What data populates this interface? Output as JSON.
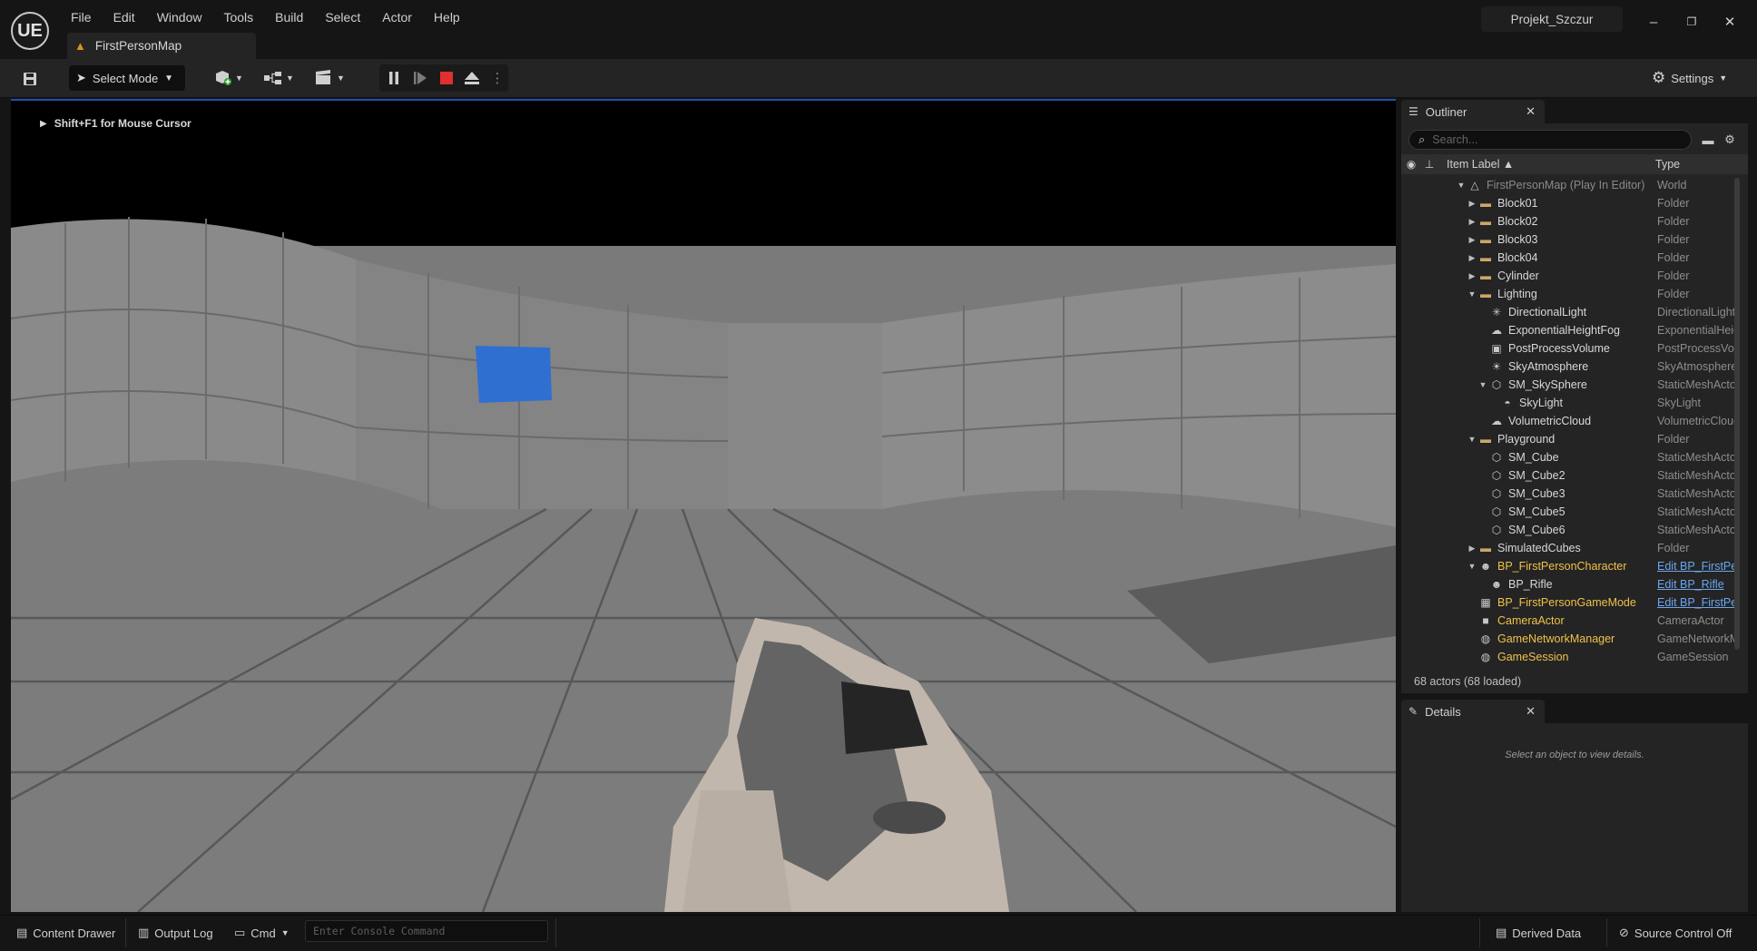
{
  "app": {
    "logo": "UE",
    "menu": [
      "File",
      "Edit",
      "Window",
      "Tools",
      "Build",
      "Select",
      "Actor",
      "Help"
    ],
    "level_tab": "FirstPersonMap",
    "project": "Projekt_Szczur",
    "window_controls": {
      "minimize": "–",
      "restore": "❐",
      "close": "✕"
    }
  },
  "toolbar": {
    "select_mode": "Select Mode",
    "settings": "Settings",
    "icons": [
      "save-icon",
      "add-actor-icon",
      "blueprint-icon",
      "cinematics-icon",
      "pause-icon",
      "step-icon",
      "stop-icon",
      "eject-icon",
      "more-icon"
    ]
  },
  "viewport": {
    "mouse_hint": "Shift+F1 for Mouse Cursor",
    "accent_color": "#1e4fa8",
    "target_color": "#2f6fd0"
  },
  "outliner": {
    "tab_label": "Outliner",
    "search_placeholder": "Search...",
    "col_label": "Item Label ▲",
    "col_type": "Type",
    "rows": [
      {
        "label": "FirstPersonMap (Play In Editor)",
        "type": "World",
        "indent": 0,
        "arrow": "▼",
        "icon": "△",
        "dim": true
      },
      {
        "label": "Block01",
        "type": "Folder",
        "indent": 1,
        "arrow": "▶",
        "icon": "▬"
      },
      {
        "label": "Block02",
        "type": "Folder",
        "indent": 1,
        "arrow": "▶",
        "icon": "▬"
      },
      {
        "label": "Block03",
        "type": "Folder",
        "indent": 1,
        "arrow": "▶",
        "icon": "▬"
      },
      {
        "label": "Block04",
        "type": "Folder",
        "indent": 1,
        "arrow": "▶",
        "icon": "▬"
      },
      {
        "label": "Cylinder",
        "type": "Folder",
        "indent": 1,
        "arrow": "▶",
        "icon": "▬"
      },
      {
        "label": "Lighting",
        "type": "Folder",
        "indent": 1,
        "arrow": "▼",
        "icon": "▬"
      },
      {
        "label": "DirectionalLight",
        "type": "DirectionalLight",
        "indent": 2,
        "arrow": "",
        "icon": "✳"
      },
      {
        "label": "ExponentialHeightFog",
        "type": "ExponentialHeightFog",
        "indent": 2,
        "arrow": "",
        "icon": "☁"
      },
      {
        "label": "PostProcessVolume",
        "type": "PostProcessVolume",
        "indent": 2,
        "arrow": "",
        "icon": "▣"
      },
      {
        "label": "SkyAtmosphere",
        "type": "SkyAtmosphere",
        "indent": 2,
        "arrow": "",
        "icon": "☀"
      },
      {
        "label": "SM_SkySphere",
        "type": "StaticMeshActor",
        "indent": 2,
        "arrow": "▼",
        "icon": "⬡"
      },
      {
        "label": "SkyLight",
        "type": "SkyLight",
        "indent": 3,
        "arrow": "",
        "icon": "◓"
      },
      {
        "label": "VolumetricCloud",
        "type": "VolumetricCloud",
        "indent": 2,
        "arrow": "",
        "icon": "☁"
      },
      {
        "label": "Playground",
        "type": "Folder",
        "indent": 1,
        "arrow": "▼",
        "icon": "▬"
      },
      {
        "label": "SM_Cube",
        "type": "StaticMeshActor",
        "indent": 2,
        "arrow": "",
        "icon": "⬡"
      },
      {
        "label": "SM_Cube2",
        "type": "StaticMeshActor",
        "indent": 2,
        "arrow": "",
        "icon": "⬡"
      },
      {
        "label": "SM_Cube3",
        "type": "StaticMeshActor",
        "indent": 2,
        "arrow": "",
        "icon": "⬡"
      },
      {
        "label": "SM_Cube5",
        "type": "StaticMeshActor",
        "indent": 2,
        "arrow": "",
        "icon": "⬡"
      },
      {
        "label": "SM_Cube6",
        "type": "StaticMeshActor",
        "indent": 2,
        "arrow": "",
        "icon": "⬡"
      },
      {
        "label": "SimulatedCubes",
        "type": "Folder",
        "indent": 1,
        "arrow": "▶",
        "icon": "▬"
      },
      {
        "label": "BP_FirstPersonCharacter",
        "type": "Edit BP_FirstPersonCharacter",
        "indent": 1,
        "arrow": "▼",
        "icon": "☻",
        "link": true,
        "highlight": true
      },
      {
        "label": "BP_Rifle",
        "type": "Edit BP_Rifle",
        "indent": 2,
        "arrow": "",
        "icon": "☻",
        "link": true
      },
      {
        "label": "BP_FirstPersonGameMode",
        "type": "Edit BP_FirstPersonGameMode",
        "indent": 1,
        "arrow": "",
        "icon": "▦",
        "link": true,
        "highlight": true
      },
      {
        "label": "CameraActor",
        "type": "CameraActor",
        "indent": 1,
        "arrow": "",
        "icon": "■",
        "highlight": true
      },
      {
        "label": "GameNetworkManager",
        "type": "GameNetworkManager",
        "indent": 1,
        "arrow": "",
        "icon": "◍",
        "highlight": true
      },
      {
        "label": "GameSession",
        "type": "GameSession",
        "indent": 1,
        "arrow": "",
        "icon": "◍",
        "highlight": true
      }
    ],
    "actor_count": "68 actors (68 loaded)",
    "highlight_color": "#f0c24a",
    "link_color": "#6aa6f0"
  },
  "details": {
    "tab_label": "Details",
    "empty_text": "Select an object to view details."
  },
  "statusbar": {
    "content_drawer": "Content Drawer",
    "output_log": "Output Log",
    "cmd": "Cmd",
    "console_placeholder": "Enter Console Command",
    "derived_data": "Derived Data",
    "source_control": "Source Control Off"
  }
}
